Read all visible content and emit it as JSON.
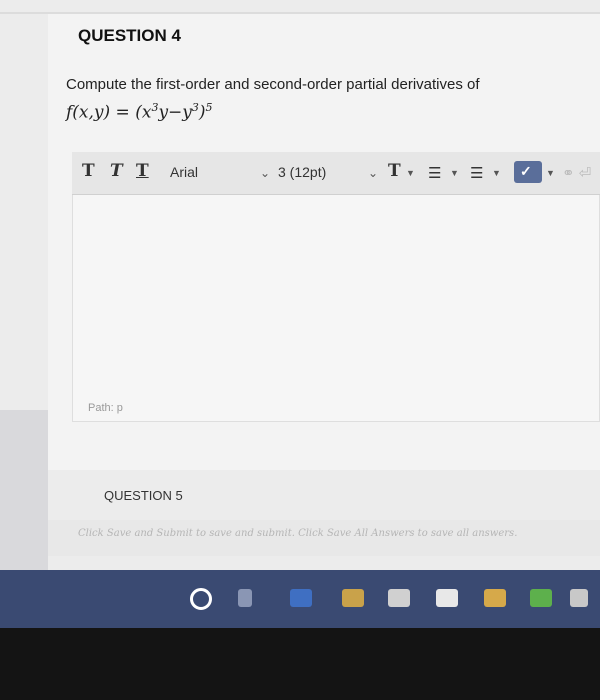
{
  "question4": {
    "title": "QUESTION 4",
    "prompt": "Compute the first-order and second-order partial derivatives of",
    "formula_main": "f(x,y) = (x",
    "formula_exp1": "3",
    "formula_mid": "y−y",
    "formula_exp2": "3",
    "formula_close": ")",
    "formula_exp3": "5"
  },
  "toolbar": {
    "t1": "T",
    "t2": "T",
    "t3": "T",
    "font": "Arial",
    "size": "3 (12pt)",
    "text_color": "T",
    "bullets": "☰",
    "numbers": "☰",
    "spell": "✓",
    "link": "⚭ ⏎"
  },
  "editor": {
    "path": "Path: p"
  },
  "question5": {
    "title": "QUESTION 5"
  },
  "savebar": {
    "text": "Click Save and Submit to save and submit. Click Save All Answers to save all answers."
  },
  "colors": {
    "taskbar": "#3a4a72",
    "spell_bg": "#5a6e9a"
  }
}
